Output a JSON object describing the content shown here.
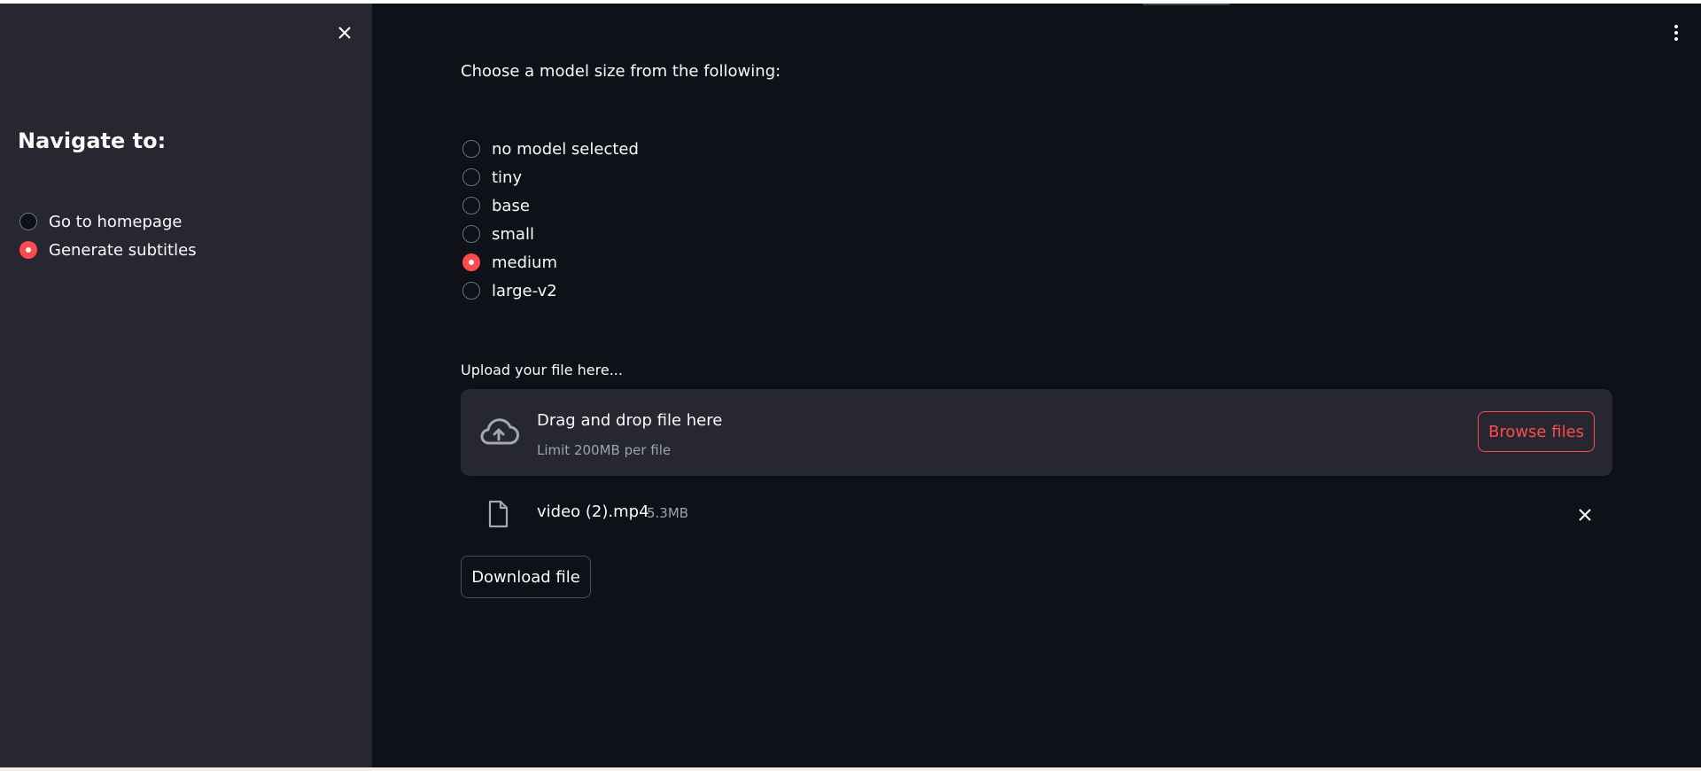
{
  "sidebar": {
    "title": "Navigate to:",
    "items": [
      {
        "label": "Go to homepage",
        "selected": false
      },
      {
        "label": "Generate subtitles",
        "selected": true
      }
    ]
  },
  "main": {
    "model_question": "Choose a model size from the following:",
    "model_options": [
      {
        "label": "no model selected",
        "selected": false
      },
      {
        "label": "tiny",
        "selected": false
      },
      {
        "label": "base",
        "selected": false
      },
      {
        "label": "small",
        "selected": false
      },
      {
        "label": "medium",
        "selected": true
      },
      {
        "label": "large-v2",
        "selected": false
      }
    ],
    "upload_label": "Upload your file here...",
    "dropzone": {
      "title": "Drag and drop file here",
      "limit": "Limit 200MB per file",
      "browse_label": "Browse files"
    },
    "file": {
      "name": "video (2).mp4",
      "size": "5.3MB"
    },
    "download_label": "Download file"
  },
  "colors": {
    "accent": "#ff4b4b",
    "background": "#0e1117",
    "sidebar": "#262730"
  },
  "icons": [
    "close-icon",
    "more-vertical-icon",
    "cloud-upload-icon",
    "file-icon",
    "remove-file-icon"
  ]
}
